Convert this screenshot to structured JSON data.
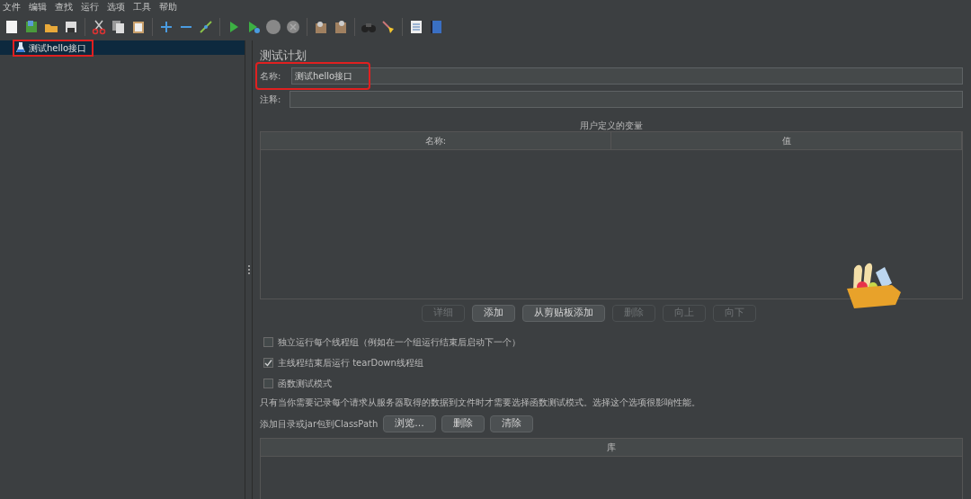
{
  "menu": [
    "文件",
    "编辑",
    "查找",
    "运行",
    "选项",
    "工具",
    "帮助"
  ],
  "tree": [
    {
      "label": "测试hello接口",
      "selected": true,
      "highlighted": true
    }
  ],
  "panel": {
    "title": "测试计划",
    "name_field": {
      "label": "名称:",
      "value": "测试hello接口",
      "highlighted": true
    },
    "comment_field": {
      "label": "注释:"
    },
    "variables": {
      "title": "用户定义的变量",
      "columns": [
        "名称:",
        "值"
      ]
    },
    "buttons": [
      {
        "label": "详细",
        "disabled": true
      },
      {
        "label": "添加",
        "disabled": false
      },
      {
        "label": "从剪贴板添加",
        "disabled": false
      },
      {
        "label": "删除",
        "disabled": true
      },
      {
        "label": "向上",
        "disabled": true
      },
      {
        "label": "向下",
        "disabled": true
      }
    ],
    "options": [
      {
        "label": "独立运行每个线程组（例如在一个组运行结束后启动下一个）",
        "checked": false
      },
      {
        "label": "主线程结束后运行 tearDown线程组",
        "checked": true
      },
      {
        "label": "函数测试模式",
        "checked": false
      }
    ],
    "note": "只有当你需要记录每个请求从服务器取得的数据到文件时才需要选择函数测试模式。选择这个选项很影响性能。",
    "classpath": {
      "label": "添加目录或jar包到ClassPath",
      "buttons": [
        "浏览...",
        "删除",
        "清除"
      ],
      "columns": [
        "库"
      ]
    }
  }
}
